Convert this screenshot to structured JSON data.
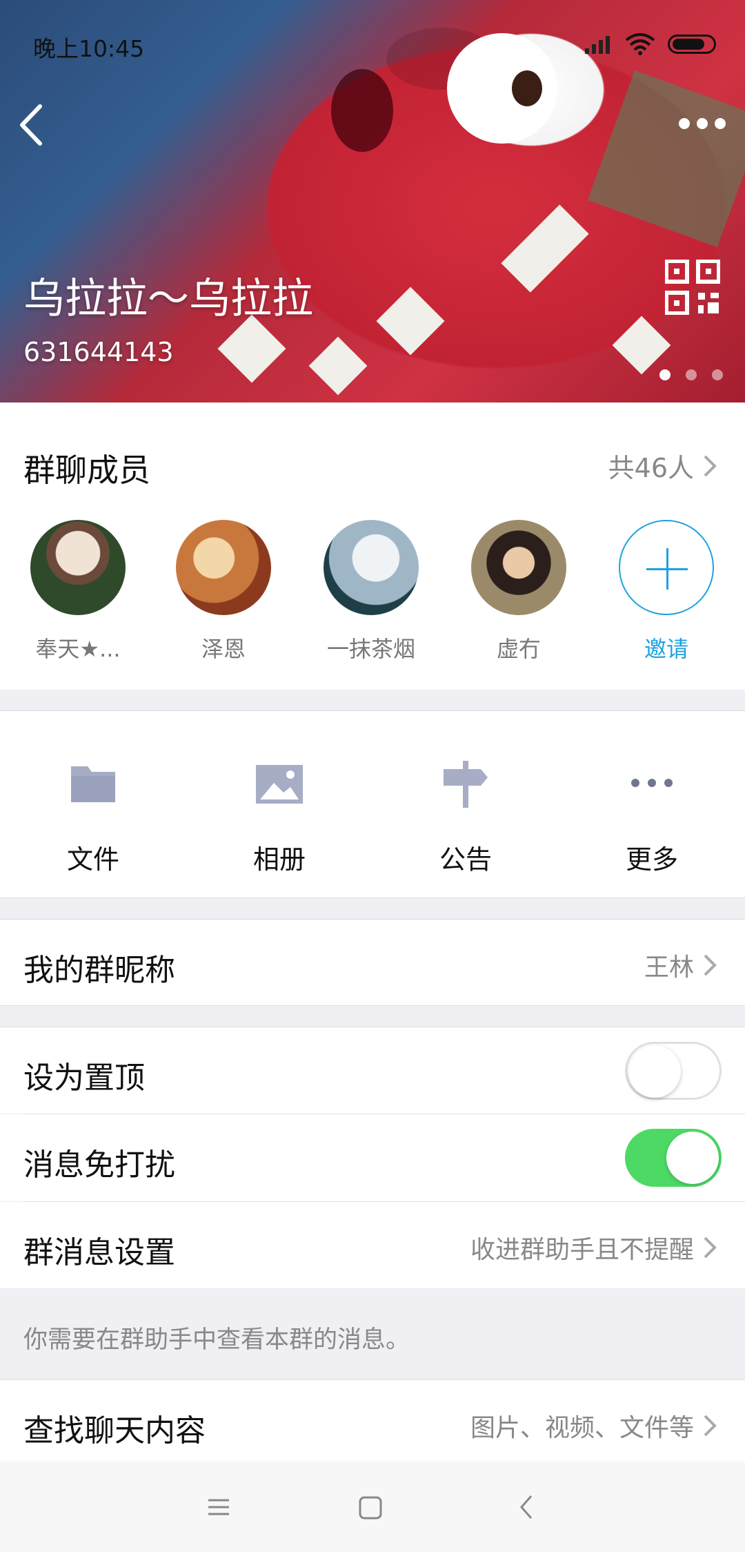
{
  "status_bar": {
    "time": "晚上10:45"
  },
  "header": {
    "group_name": "乌拉拉～乌拉拉",
    "group_id": "631644143",
    "page_dots": {
      "count": 3,
      "active": 1
    }
  },
  "members": {
    "title": "群聊成员",
    "count": "共46人",
    "items": [
      {
        "name": "奉天★..."
      },
      {
        "name": "泽恩"
      },
      {
        "name": "一抹茶烟"
      },
      {
        "name": "虚冇"
      }
    ],
    "invite_label": "邀请"
  },
  "features": {
    "items": [
      {
        "label": "文件",
        "icon": "folder-icon"
      },
      {
        "label": "相册",
        "icon": "image-icon"
      },
      {
        "label": "公告",
        "icon": "signpost-icon"
      },
      {
        "label": "更多",
        "icon": "more-dots-icon"
      }
    ]
  },
  "settings": {
    "nickname_label": "我的群昵称",
    "nickname_value": "王林",
    "pin_label": "设为置顶",
    "pin_on": false,
    "mute_label": "消息免打扰",
    "mute_on": true,
    "msg_settings_label": "群消息设置",
    "msg_settings_value": "收进群助手且不提醒",
    "note": "你需要在群助手中查看本群的消息。",
    "search_label": "查找聊天内容",
    "search_value": "图片、视频、文件等"
  },
  "colors": {
    "accent": "#1da1e0",
    "toggle_on": "#4cd964",
    "header_red": "#c22334"
  }
}
